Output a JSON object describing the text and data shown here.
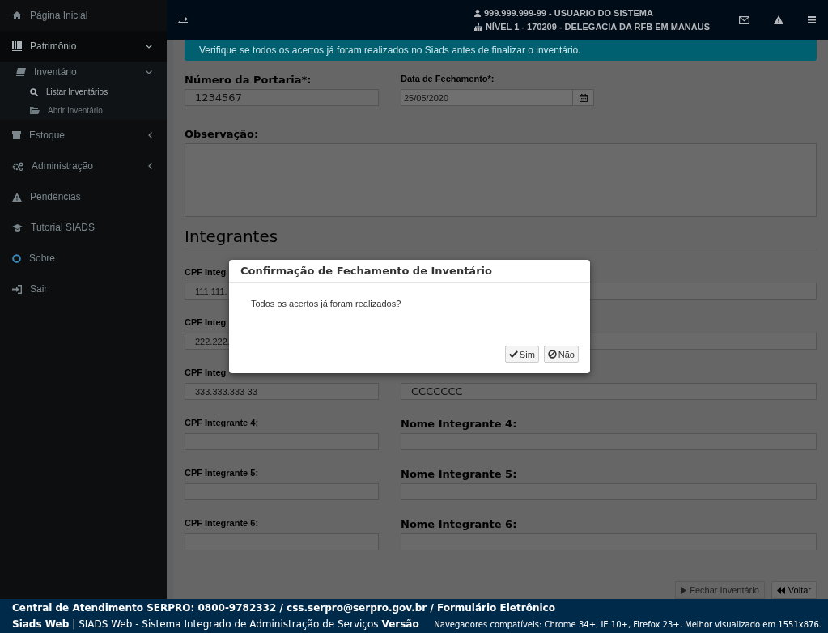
{
  "sidebar": {
    "items": [
      {
        "label": "Página Inicial"
      },
      {
        "label": "Patrimônio",
        "expanded": true,
        "children": [
          {
            "label": "Inventário",
            "expanded": true,
            "children": [
              {
                "label": "Listar Inventários",
                "selected": true
              },
              {
                "label": "Abrir Inventário",
                "selected": false
              }
            ]
          }
        ]
      },
      {
        "label": "Estoque",
        "expanded": false
      },
      {
        "label": "Administração",
        "expanded": false
      },
      {
        "label": "Pendências"
      },
      {
        "label": "Tutorial SIADS"
      },
      {
        "label": "Sobre"
      },
      {
        "label": "Sair"
      }
    ]
  },
  "header": {
    "user_line": "999.999.999-99 - USUARIO DO SISTEMA",
    "unit_line": "NÍVEL 1 - 170209 - DELEGACIA DA RFB EM MANAUS"
  },
  "alert": "Verifique se todos os acertos já foram realizados no Siads antes de finalizar o inventário.",
  "form": {
    "portaria": {
      "label": "Número da Portaria*:",
      "value": "1234567"
    },
    "data_fechamento": {
      "label": "Data de Fechamento*:",
      "value": "25/05/2020"
    },
    "observacao": {
      "label": "Observação:"
    },
    "integrantes_title": "Integrantes",
    "integrantes": [
      {
        "cpf_label": "CPF Integ",
        "cpf_value": "111.111."
      },
      {
        "cpf_label": "CPF Integ",
        "cpf_value": "222.222."
      },
      {
        "cpf_label": "CPF Integ",
        "cpf_value": "333.333.333-33",
        "nome_value": "CCCCCCC"
      },
      {
        "cpf_label": "CPF Integrante 4:",
        "nome_label": "Nome Integrante 4:"
      },
      {
        "cpf_label": "CPF Integrante 5:",
        "nome_label": "Nome Integrante 5:"
      },
      {
        "cpf_label": "CPF Integrante 6:",
        "nome_label": "Nome Integrante 6:"
      }
    ],
    "actions": [
      {
        "label": "Fechar Inventário",
        "kind": "play",
        "disabled": true
      },
      {
        "label": "Voltar",
        "kind": "back",
        "disabled": false
      }
    ]
  },
  "modal": {
    "title": "Confirmação de Fechamento de Inventário",
    "message": "Todos os acertos já foram realizados?",
    "buttons": [
      {
        "label": "Sim",
        "kind": "confirm"
      },
      {
        "label": "Não",
        "kind": "cancel"
      }
    ]
  },
  "footer": {
    "contact": "Central de Atendimento SERPRO: 0800-9782332 / css.serpro@serpro.gov.br / Formulário Eletrônico",
    "brand": "Siads Web",
    "system": "| SIADS Web - Sistema Integrado de Administração de Serviços",
    "version": "Versão",
    "browsers": "Navegadores compatíveis: Chrome 34+, IE 10+, Firefox 23+. Melhor visualizado em 1551x876."
  }
}
